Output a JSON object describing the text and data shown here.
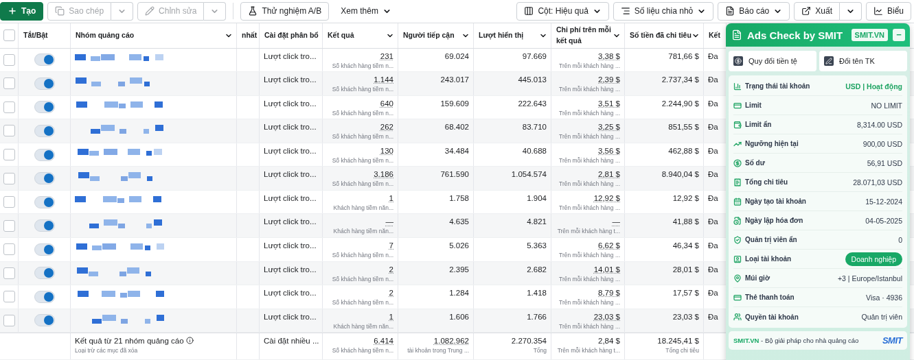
{
  "toolbar": {
    "left": [
      {
        "kind": "primary",
        "label": "Tạo",
        "disabled": false
      },
      {
        "kind": "split",
        "label": "Sao chép",
        "disabled": true
      },
      {
        "kind": "split",
        "label": "Chỉnh sửa",
        "disabled": true
      },
      {
        "kind": "outlined",
        "label": "Thử nghiệm A/B",
        "disabled": false
      },
      {
        "kind": "text",
        "label": "Xem thêm",
        "disabled": false
      }
    ],
    "right": [
      {
        "kind": "menu",
        "label": "Cột: Hiệu quả"
      },
      {
        "kind": "menu",
        "label": "Số liệu chia nhỏ"
      },
      {
        "kind": "menu",
        "label": "Báo cáo"
      },
      {
        "kind": "split",
        "label": "Xuất"
      },
      {
        "kind": "plain",
        "label": "Biểu"
      }
    ]
  },
  "table": {
    "header_checked": false,
    "columns": [
      {
        "label": "Tắt/Bật",
        "menu": false
      },
      {
        "label": "Nhóm quảng cáo",
        "menu": true
      },
      {
        "label": "nhất",
        "menu": false
      },
      {
        "label": "Cài đặt phân bổ",
        "menu": false
      },
      {
        "label": "Kết quả",
        "menu": true
      },
      {
        "label": "Người tiếp cận",
        "menu": true
      },
      {
        "label": "Lượt hiển thị",
        "menu": true
      },
      {
        "label": "Chi phí trên mỗi kết quả",
        "menu": true
      },
      {
        "label": "Số tiền đã chi tiêu",
        "menu": true
      },
      {
        "label": "Kết",
        "menu": false
      }
    ],
    "rows": [
      {
        "on": true,
        "checked": false,
        "setting": "Lượt click tro...",
        "result": "231",
        "result_note": "Số khách hàng tiềm n...",
        "reach": "69.024",
        "impressions": "97.669",
        "cost": "3,38 $",
        "cost_note": "Trên mỗi khách hàng ...",
        "spent": "781,66 $",
        "column_10": "Đa"
      },
      {
        "on": true,
        "checked": false,
        "setting": "Lượt click tro...",
        "result": "1.144",
        "result_note": "Số khách hàng tiềm n...",
        "reach": "243.017",
        "impressions": "445.013",
        "cost": "2,39 $",
        "cost_note": "Trên mỗi khách hàng ...",
        "spent": "2.737,34 $",
        "column_10": "Đa"
      },
      {
        "on": true,
        "checked": false,
        "setting": "Lượt click tro...",
        "result": "640",
        "result_note": "Số khách hàng tiềm n...",
        "reach": "159.609",
        "impressions": "222.643",
        "cost": "3,51 $",
        "cost_note": "Trên mỗi khách hàng ...",
        "spent": "2.244,90 $",
        "column_10": "Đa"
      },
      {
        "on": true,
        "checked": false,
        "setting": "Lượt click tro...",
        "result": "262",
        "result_note": "Số khách hàng tiềm n...",
        "reach": "68.402",
        "impressions": "83.710",
        "cost": "3,25 $",
        "cost_note": "Trên mỗi khách hàng ...",
        "spent": "851,55 $",
        "column_10": "Đa"
      },
      {
        "on": true,
        "checked": false,
        "setting": "Lượt click tro...",
        "result": "130",
        "result_note": "Số khách hàng tiềm n...",
        "reach": "34.484",
        "impressions": "40.688",
        "cost": "3,56 $",
        "cost_note": "Trên mỗi khách hàng ...",
        "spent": "462,88 $",
        "column_10": "Đa"
      },
      {
        "on": true,
        "checked": false,
        "setting": "Lượt click tro...",
        "result": "3.186",
        "result_note": "Số khách hàng tiềm n...",
        "reach": "761.590",
        "impressions": "1.054.574",
        "cost": "2,81 $",
        "cost_note": "Trên mỗi khách hàng ...",
        "spent": "8.940,04 $",
        "column_10": "Đa"
      },
      {
        "on": true,
        "checked": false,
        "setting": "Lượt click tro...",
        "result": "1",
        "result_note": "Khách hàng tiềm năn...",
        "reach": "1.758",
        "impressions": "1.904",
        "cost": "12,92 $",
        "cost_note": "Trên mỗi khách hàng ...",
        "spent": "12,92 $",
        "column_10": "Đa"
      },
      {
        "on": true,
        "checked": false,
        "setting": "Lượt click tro...",
        "result": "—",
        "result_note": "Khách hàng tiềm năn...",
        "reach": "4.635",
        "impressions": "4.821",
        "cost": "—",
        "cost_note": "Trên mỗi khách hàng t...",
        "spent": "41,88 $",
        "column_10": "Đa"
      },
      {
        "on": true,
        "checked": false,
        "setting": "Lượt click tro...",
        "result": "7",
        "result_note": "Số khách hàng tiềm n...",
        "reach": "5.026",
        "impressions": "5.363",
        "cost": "6,62 $",
        "cost_note": "Trên mỗi khách hàng ...",
        "spent": "46,34 $",
        "column_10": "Đa"
      },
      {
        "on": true,
        "checked": false,
        "setting": "Lượt click tro...",
        "result": "2",
        "result_note": "Số khách hàng tiềm n...",
        "reach": "2.395",
        "impressions": "2.682",
        "cost": "14,01 $",
        "cost_note": "Trên mỗi khách hàng ...",
        "spent": "28,01 $",
        "column_10": "Đa"
      },
      {
        "on": true,
        "checked": false,
        "setting": "Lượt click tro...",
        "result": "2",
        "result_note": "Số khách hàng tiềm n...",
        "reach": "1.284",
        "impressions": "1.418",
        "cost": "8,79 $",
        "cost_note": "Trên mỗi khách hàng ...",
        "spent": "17,57 $",
        "column_10": "Đa"
      },
      {
        "on": true,
        "checked": false,
        "setting": "Lượt click tro...",
        "result": "1",
        "result_note": "Khách hàng tiềm năn...",
        "reach": "1.606",
        "impressions": "1.766",
        "cost": "23,03 $",
        "cost_note": "Trên mỗi khách hàng ...",
        "spent": "23,03 $",
        "column_10": "Đa"
      }
    ],
    "summary": {
      "title": "Kết quả từ 21 nhóm quảng cáo",
      "note": "Loại trừ các mục đã xóa",
      "setting": "Cài đặt nhiều ...",
      "result": "6.414",
      "result_note": "Số khách hàng tiềm n...",
      "reach": "1.082.962",
      "reach_note": "tài khoản trong Trung ...",
      "impressions": "2.270.354",
      "impressions_note": "Tổng",
      "cost": "2,84 $",
      "cost_note": "Trên mỗi khách hàng t...",
      "spent": "18.245,41 $",
      "spent_note": "Tổng chi tiêu"
    }
  },
  "panel": {
    "title": "Ads Check by SMIT",
    "badge": "SMIT.VN",
    "minimize": "−",
    "actions": [
      "Quy đổi tiền tệ",
      "Đổi tên TK"
    ],
    "rows": [
      {
        "kind": "status",
        "label": "Trạng thái tài khoản",
        "value": "USD | Hoạt động"
      },
      {
        "kind": "text",
        "label": "Limit",
        "value": "NO LIMIT"
      },
      {
        "kind": "text",
        "label": "Limit ẩn",
        "value": "8,314.00 USD"
      },
      {
        "kind": "text",
        "label": "Ngưỡng hiện tại",
        "value": "900,00 USD"
      },
      {
        "kind": "text",
        "label": "Số dư",
        "value": "56,91 USD"
      },
      {
        "kind": "text",
        "label": "Tổng chi tiêu",
        "value": "28.071,03 USD"
      },
      {
        "kind": "text",
        "label": "Ngày tạo tài khoản",
        "value": "15-12-2024"
      },
      {
        "kind": "text",
        "label": "Ngày lập hóa đơn",
        "value": "04-05-2025"
      },
      {
        "kind": "text",
        "label": "Quản trị viên ẩn",
        "value": "0"
      },
      {
        "kind": "pill",
        "label": "Loại tài khoản",
        "value": "Doanh nghiệp"
      },
      {
        "kind": "text",
        "label": "Múi giờ",
        "value": "+3 | Europe/Istanbul"
      },
      {
        "kind": "text",
        "label": "Thẻ thanh toán",
        "value": "Visa · 4936"
      },
      {
        "kind": "text",
        "label": "Quyền tài khoản",
        "value": "Quản trị viên"
      }
    ],
    "footer": {
      "link": "SMIT.VN",
      "text": " - Bộ giải pháp cho nhà quảng cáo",
      "logo": "SMIT"
    }
  }
}
